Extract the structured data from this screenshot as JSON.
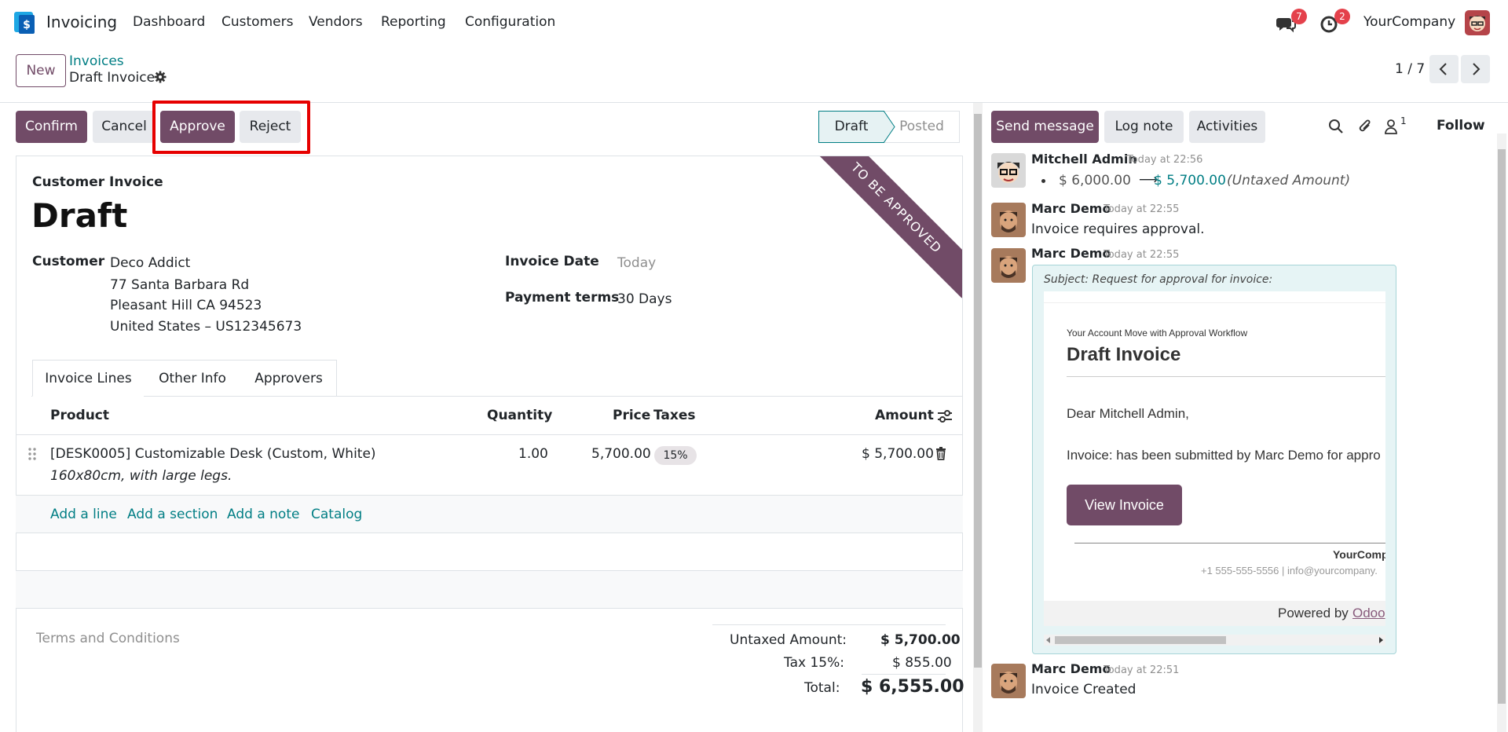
{
  "app": {
    "name": "Invoicing",
    "menu": [
      "Dashboard",
      "Customers",
      "Vendors",
      "Reporting",
      "Configuration"
    ],
    "messages_count": "7",
    "activities_count": "2",
    "company": "YourCompany"
  },
  "control": {
    "new_label": "New",
    "breadcrumb_parent": "Invoices",
    "breadcrumb_current": "Draft Invoice",
    "pager": "1 / 7"
  },
  "actions": {
    "confirm": "Confirm",
    "cancel": "Cancel",
    "approve": "Approve",
    "reject": "Reject"
  },
  "statusbar": {
    "draft": "Draft",
    "posted": "Posted"
  },
  "invoice": {
    "ribbon": "TO BE APPROVED",
    "type": "Customer Invoice",
    "state": "Draft",
    "customer_label": "Customer",
    "customer_name": "Deco Addict",
    "address1": "77 Santa Barbara Rd",
    "address2": "Pleasant Hill CA 94523",
    "address3": "United States – US12345673",
    "date_label": "Invoice Date",
    "date_value": "Today",
    "terms_label": "Payment terms",
    "terms_value": "30 Days"
  },
  "tabs": [
    "Invoice Lines",
    "Other Info",
    "Approvers"
  ],
  "lines": {
    "headers": {
      "product": "Product",
      "quantity": "Quantity",
      "price": "Price",
      "taxes": "Taxes",
      "amount": "Amount"
    },
    "row": {
      "product": "[DESK0005] Customizable Desk (Custom, White)",
      "description": "160x80cm, with large legs.",
      "quantity": "1.00",
      "price": "5,700.00",
      "tax": "15%",
      "amount": "$ 5,700.00"
    },
    "add_line": "Add a line",
    "add_section": "Add a section",
    "add_note": "Add a note",
    "catalog": "Catalog"
  },
  "totals": {
    "terms_placeholder": "Terms and Conditions",
    "untaxed_label": "Untaxed Amount:",
    "untaxed_value": "$ 5,700.00",
    "tax_label": "Tax 15%:",
    "tax_value": "$ 855.00",
    "total_label": "Total:",
    "total_value": "$ 6,555.00"
  },
  "chatter": {
    "send_message": "Send message",
    "log_note": "Log note",
    "activities": "Activities",
    "followers_count": "1",
    "follow": "Follow",
    "messages": [
      {
        "author": "Mitchell Admin",
        "time": "Today at 22:56",
        "old_value": "$ 6,000.00",
        "arrow": "⟶",
        "new_value": "$ 5,700.00",
        "field": "(Untaxed Amount)"
      },
      {
        "author": "Marc Demo",
        "time": "Today at 22:55",
        "body": "Invoice requires approval."
      },
      {
        "author": "Marc Demo",
        "time": "Today at 22:55",
        "subject": "Subject: Request for approval for invoice:",
        "email_kicker": "Your Account Move with Approval Workflow",
        "email_title": "Draft Invoice",
        "email_greeting": "Dear Mitchell Admin,",
        "email_body": "Invoice: has been submitted by Marc Demo for appro",
        "email_button": "View Invoice",
        "email_company": "YourCompa",
        "email_contact": "+1 555-555-5556 | info@yourcompany.",
        "powered_by": "Powered by",
        "powered_link": "Odoo"
      },
      {
        "author": "Marc Demo",
        "time": "Today at 22:51",
        "body": "Invoice Created"
      }
    ]
  },
  "colors": {
    "brand": "#714b67",
    "link": "#017e84",
    "highlight": "#e60000"
  }
}
